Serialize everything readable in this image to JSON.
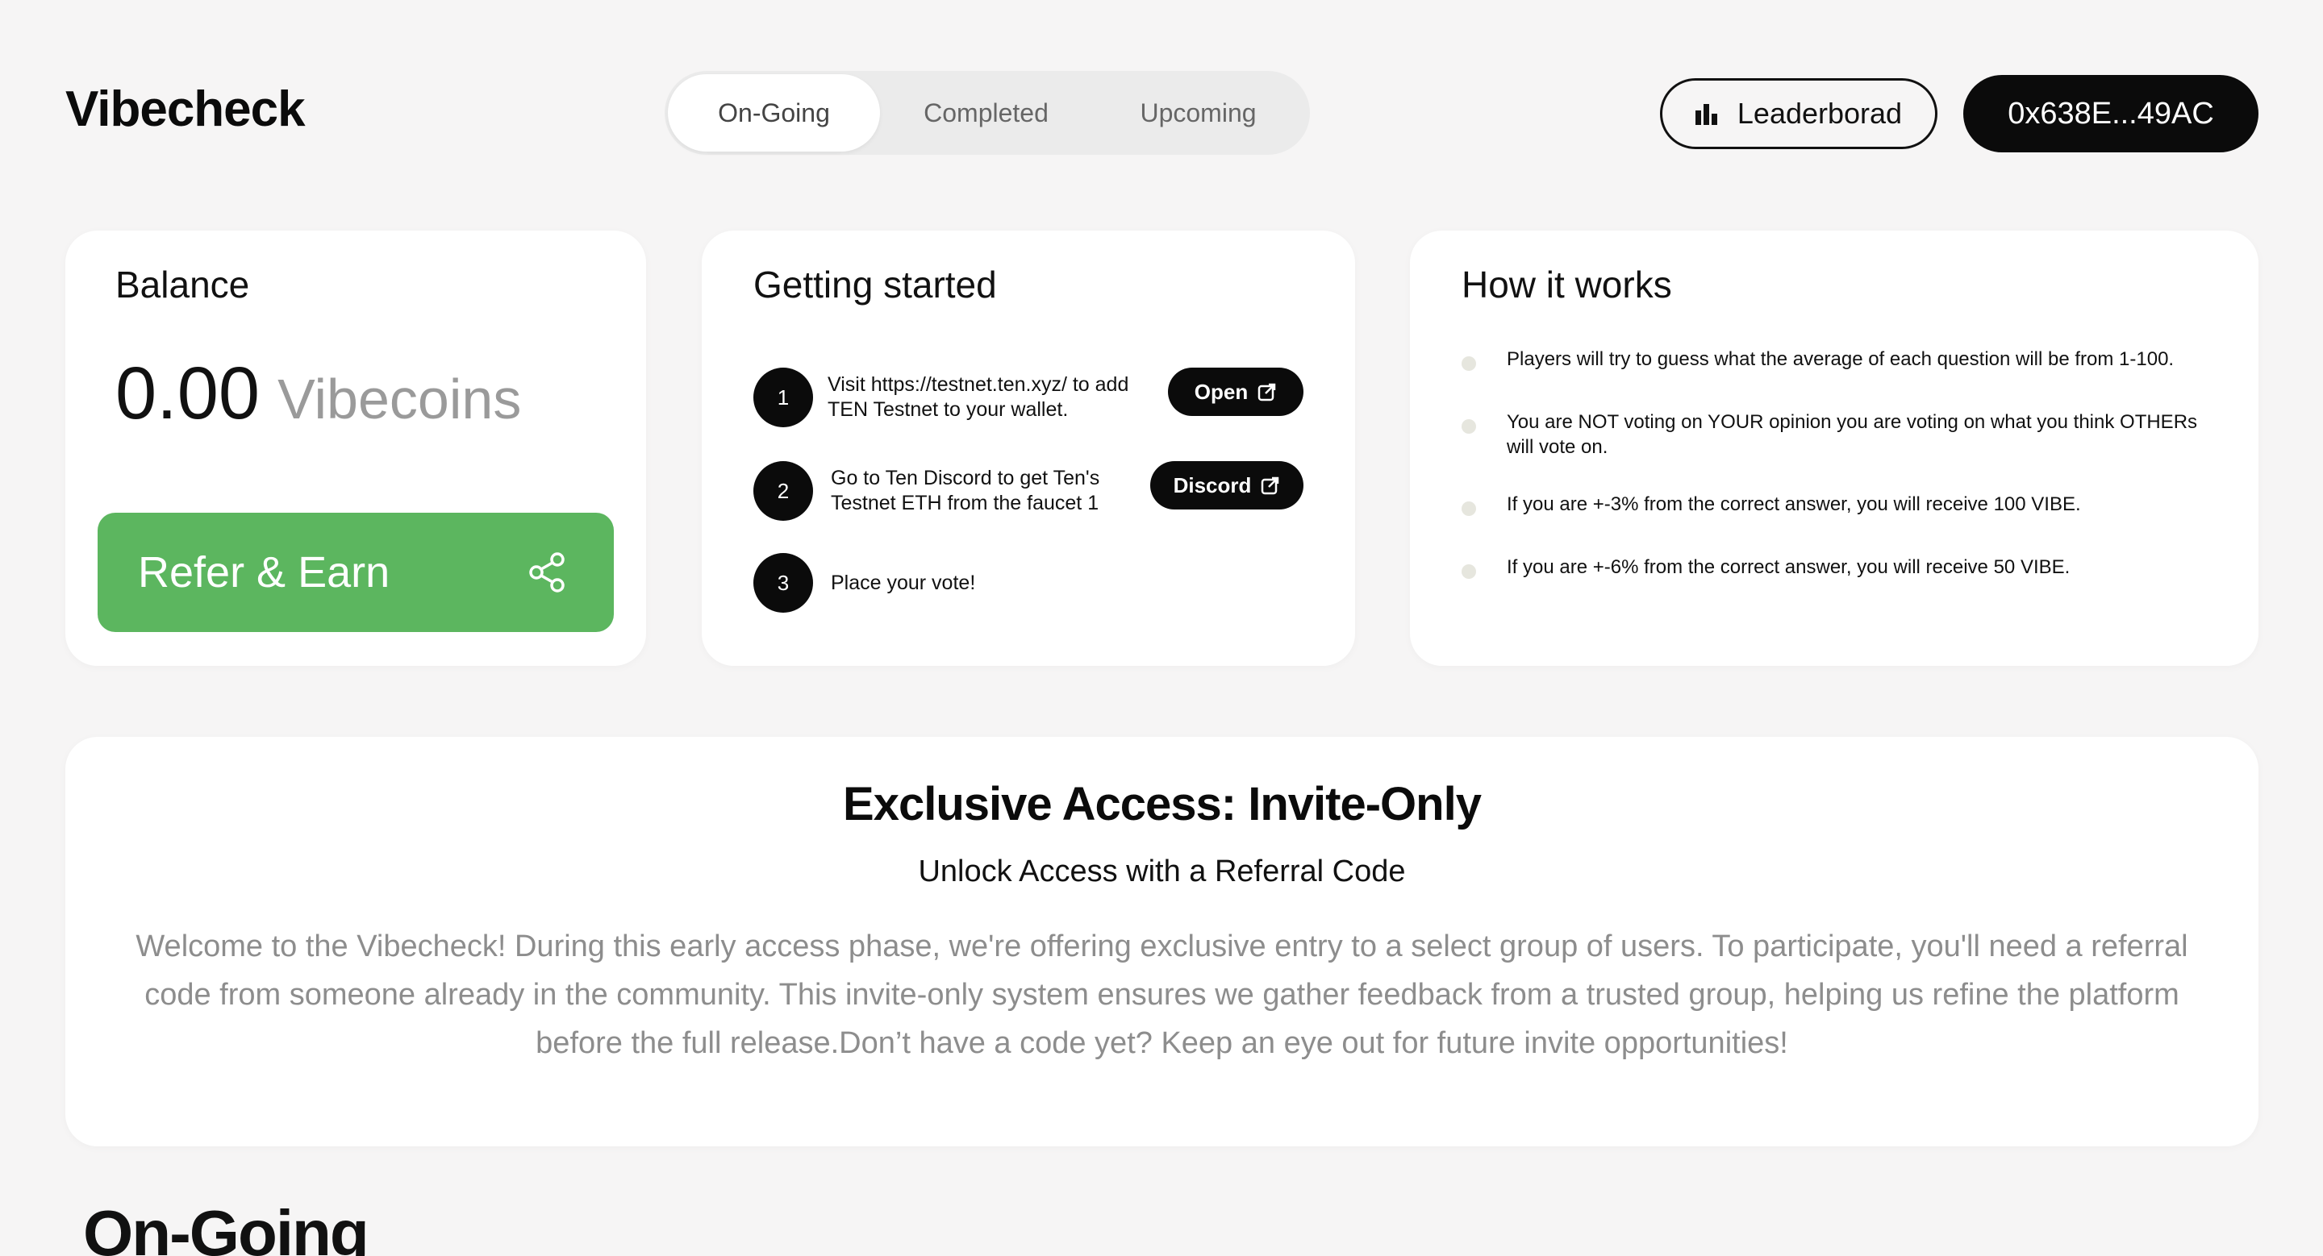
{
  "header": {
    "logo": "Vibecheck",
    "tabs": [
      {
        "label": "On-Going",
        "active": true
      },
      {
        "label": "Completed",
        "active": false
      },
      {
        "label": "Upcoming",
        "active": false
      }
    ],
    "leaderboard_label": "Leaderborad",
    "leaderboard_icon": "bar-chart-icon",
    "wallet_label": "0x638E...49AC"
  },
  "balance": {
    "title": "Balance",
    "amount": "0.00",
    "unit": "Vibecoins",
    "refer_label": "Refer & Earn",
    "refer_icon": "share-icon",
    "refer_color": "#5cb65f"
  },
  "getting_started": {
    "title": "Getting started",
    "steps": [
      {
        "num": "1",
        "text": "Visit https://testnet.ten.xyz/ to add TEN Testnet to your wallet.",
        "button": "Open"
      },
      {
        "num": "2",
        "text": "Go to Ten Discord to get Ten's Testnet ETH from the faucet 1",
        "button": "Discord"
      },
      {
        "num": "3",
        "text": "Place your vote!"
      }
    ]
  },
  "how_it_works": {
    "title": "How it works",
    "items": [
      "Players will try to guess what the average of each question will be from 1-100.",
      "You are NOT voting on YOUR opinion you are voting on what you think OTHERs will vote on.",
      "If you are +-3% from the correct answer, you will receive 100 VIBE.",
      "If you are +-6% from the correct answer, you will receive 50 VIBE."
    ]
  },
  "exclusive": {
    "title": "Exclusive Access: Invite-Only",
    "subtitle": "Unlock Access with a Referral Code",
    "body": "Welcome to the Vibecheck! During this early access phase, we're offering exclusive entry to a select group of users. To participate, you'll need a referral code from someone already in the community. This invite-only system ensures we gather feedback from a trusted group, helping us refine the platform before the full release.Don’t have a code yet? Keep an eye out for future invite opportunities!"
  },
  "section": {
    "title": "On-Going"
  }
}
